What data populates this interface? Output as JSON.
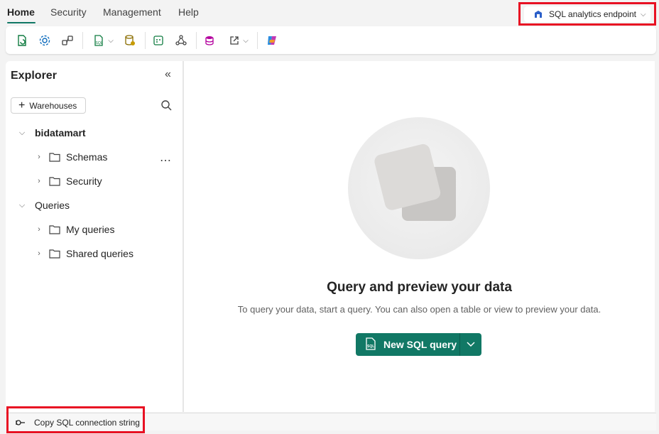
{
  "nav": {
    "tabs": [
      {
        "label": "Home",
        "active": true
      },
      {
        "label": "Security",
        "active": false
      },
      {
        "label": "Management",
        "active": false
      },
      {
        "label": "Help",
        "active": false
      }
    ],
    "endpoint_selector": "SQL analytics endpoint"
  },
  "toolbar": {
    "buttons": [
      "refresh-icon",
      "settings-icon",
      "connections-icon",
      "new-sql-query-icon",
      "get-data-icon",
      "visual-query-icon",
      "model-layout-icon",
      "reporting-icon",
      "open-in-icon",
      "copilot-icon"
    ]
  },
  "explorer": {
    "title": "Explorer",
    "add_button": "Warehouses",
    "tree": [
      {
        "label": "bidatamart",
        "level": 0,
        "expanded": true
      },
      {
        "label": "Schemas",
        "level": 1,
        "expanded": false
      },
      {
        "label": "Security",
        "level": 1,
        "expanded": false
      },
      {
        "label": "Queries",
        "level": 0,
        "expanded": true
      },
      {
        "label": "My queries",
        "level": 1,
        "expanded": false
      },
      {
        "label": "Shared queries",
        "level": 1,
        "expanded": false
      }
    ]
  },
  "main": {
    "title": "Query and preview your data",
    "subtitle": "To query your data, start a query. You can also open a table or view to preview your data.",
    "new_query_button": "New SQL query"
  },
  "footer": {
    "copy_connection": "Copy SQL connection string"
  },
  "colors": {
    "accent": "#117865",
    "highlight": "#e81123"
  }
}
